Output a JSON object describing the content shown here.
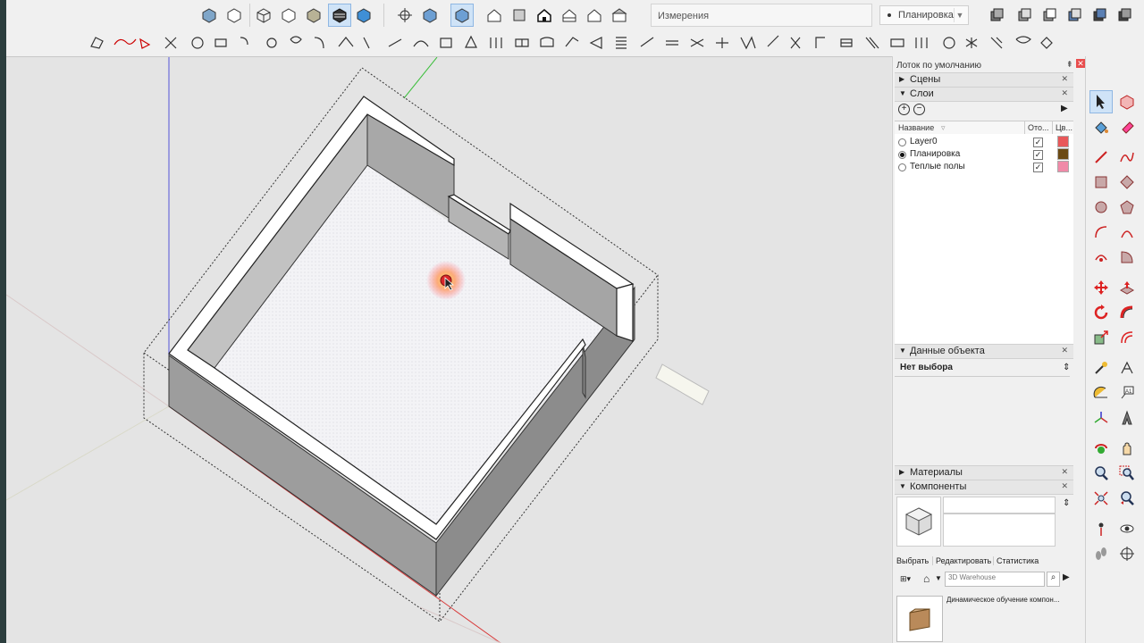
{
  "app": {
    "measurements_label": "Измерения",
    "active_layer": "Планировка"
  },
  "toolbar_top": {
    "icons": [
      "box-solid-icon",
      "box-xray-icon",
      "wireframe-icon",
      "hidden-line-icon",
      "shaded-icon",
      "shaded-texture-icon",
      "monochrome-icon",
      "camera-position-icon",
      "iso-view-icon",
      "top-view-icon",
      "house-front-icon",
      "house-right-icon",
      "house-back-icon",
      "house-left-icon",
      "house-bottom-icon",
      "component-icon-1",
      "component-icon-2",
      "component-icon-3",
      "component-icon-4",
      "component-icon-5"
    ]
  },
  "tray": {
    "title": "Лоток по умолчанию",
    "scenes_label": "Сцены",
    "layers_label": "Слои",
    "entity_info_label": "Данные объекта",
    "no_selection": "Нет выбора",
    "materials_label": "Материалы",
    "components_label": "Компоненты",
    "layers_columns": {
      "name": "Название",
      "visible": "Ото...",
      "color": "Цв..."
    },
    "layers": [
      {
        "name": "Layer0",
        "active": false,
        "visible": true,
        "color": "#e8585a"
      },
      {
        "name": "Планировка",
        "active": true,
        "visible": true,
        "color": "#6b4a14"
      },
      {
        "name": "Теплые полы",
        "active": false,
        "visible": true,
        "color": "#f08aa8"
      }
    ],
    "components_tabs": [
      "Выбрать",
      "Редактировать",
      "Статистика"
    ],
    "search_placeholder": "3D Warehouse",
    "dynamic_component_text": "Динамическое обучение компон..."
  }
}
